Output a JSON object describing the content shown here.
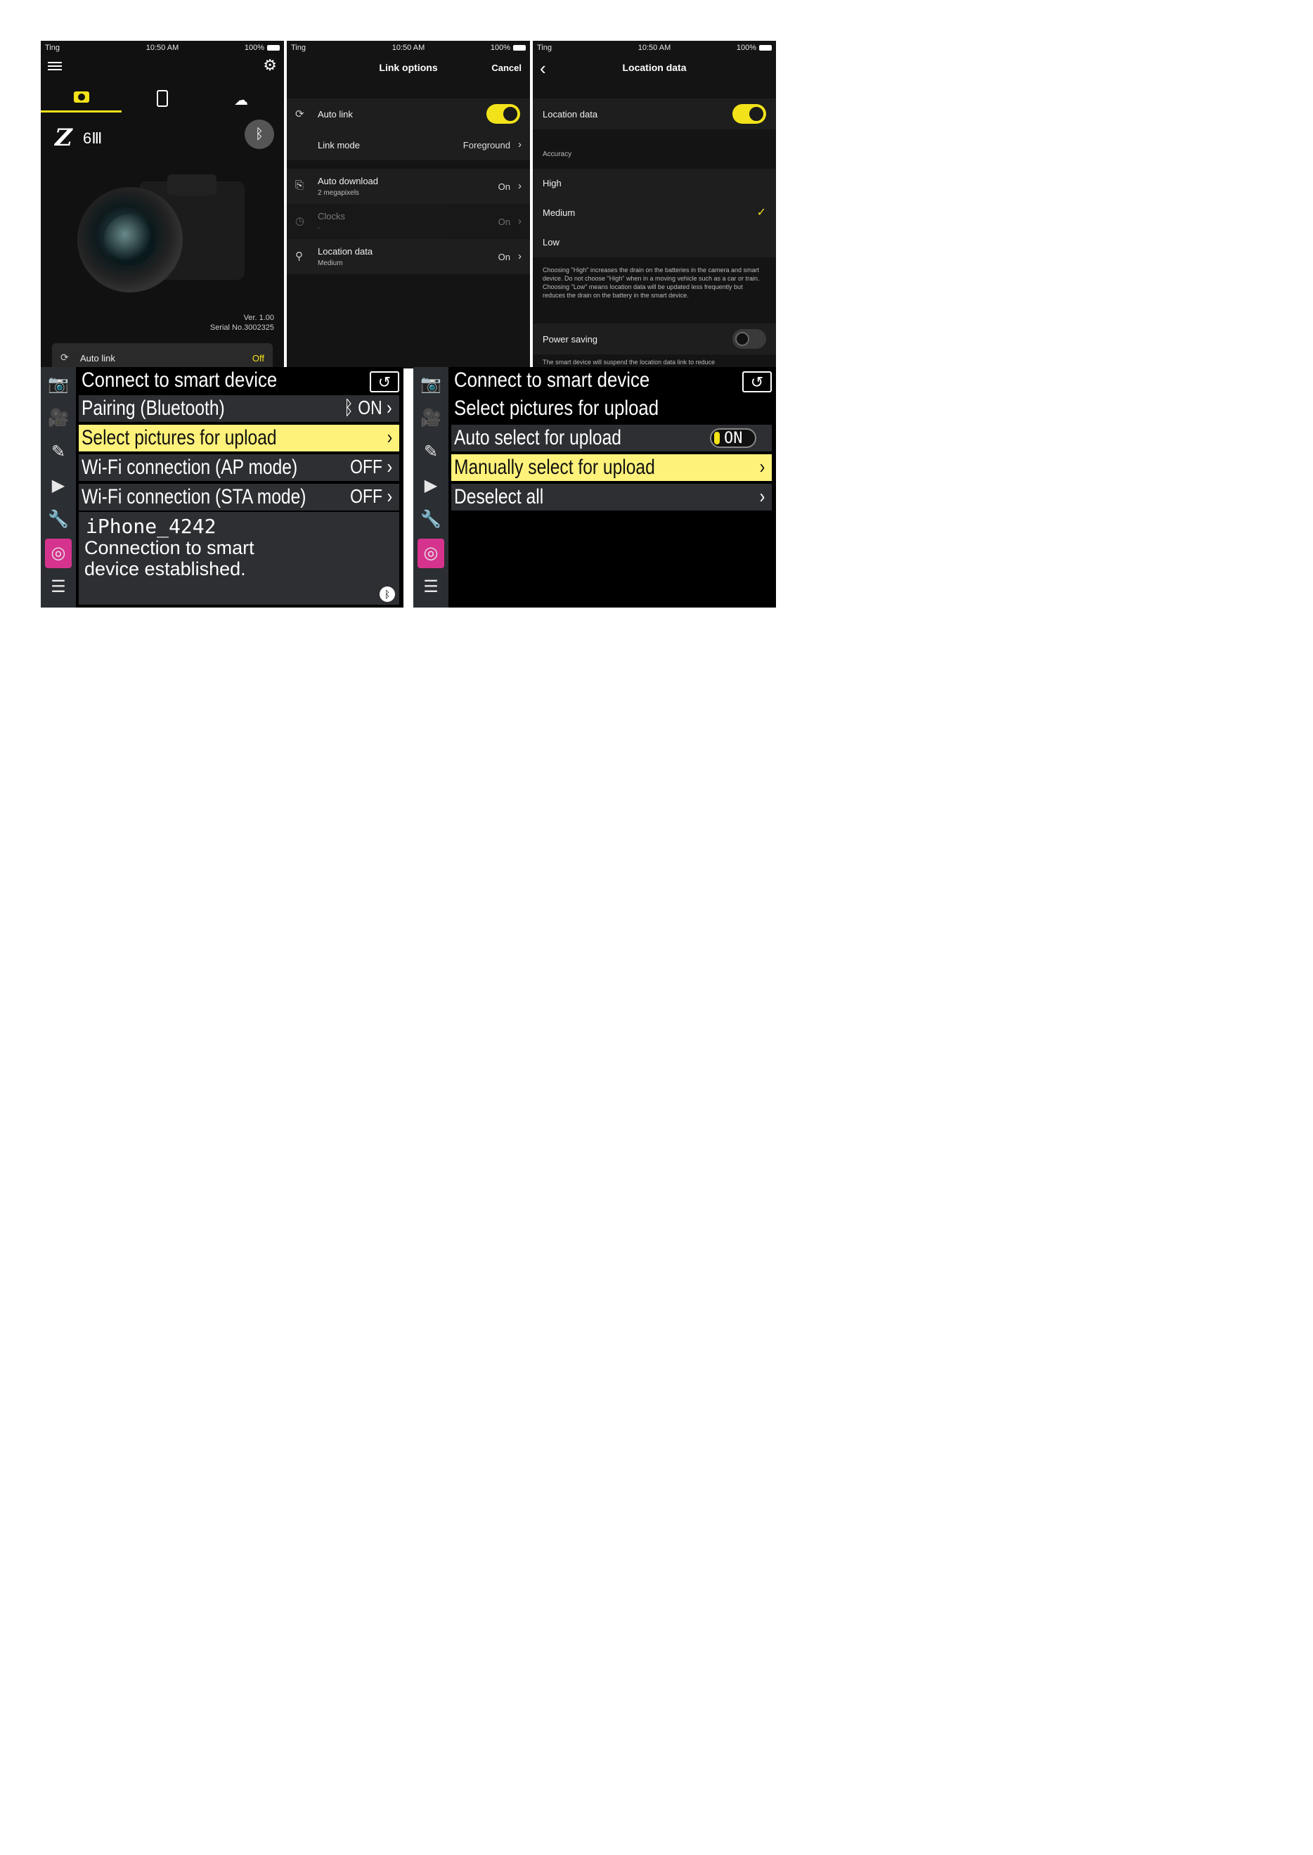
{
  "phone_status": {
    "carrier": "Ting",
    "time": "10:50 AM",
    "battery": "100%"
  },
  "screen1": {
    "model": "6Ⅲ",
    "version": "Ver. 1.00",
    "serial": "Serial No.3002325",
    "auto_link_label": "Auto link",
    "auto_link_value": "Off"
  },
  "screen2": {
    "title": "Link options",
    "cancel": "Cancel",
    "auto_link": "Auto link",
    "link_mode": "Link mode",
    "link_mode_value": "Foreground",
    "auto_download": "Auto download",
    "auto_download_sub": "2 megapixels",
    "auto_download_value": "On",
    "clocks": "Clocks",
    "clocks_sub": "-",
    "clocks_value": "On",
    "location_data": "Location data",
    "location_data_sub": "Medium",
    "location_data_value": "On"
  },
  "screen3": {
    "title": "Location data",
    "location_data": "Location data",
    "accuracy": "Accuracy",
    "high": "High",
    "medium": "Medium",
    "low": "Low",
    "description": "Choosing \"High\" increases the drain on the batteries in the camera and smart device. Do not choose \"High\" when in a moving vehicle such as a car or train. Choosing \"Low\" means location data will be updated less frequently but reduces the drain on the battery in the smart device.",
    "power_saving": "Power saving",
    "power_saving_note": "The smart device will suspend the location data link to reduce"
  },
  "camera_menu1": {
    "title": "Connect to smart device",
    "items": [
      {
        "label": "Pairing (Bluetooth)",
        "value": "ON"
      },
      {
        "label": "Select pictures for upload",
        "value": ""
      },
      {
        "label": "Wi-Fi connection (AP mode)",
        "value": "OFF"
      },
      {
        "label": "Wi-Fi connection (STA mode)",
        "value": "OFF"
      }
    ],
    "device_name": "iPhone_4242",
    "message_line1": "Connection to smart",
    "message_line2": "device established."
  },
  "camera_menu2": {
    "title": "Connect to smart device",
    "subtitle": "Select pictures for upload",
    "items": [
      {
        "label": "Auto select for upload",
        "value": "ON"
      },
      {
        "label": "Manually select for upload",
        "value": ""
      },
      {
        "label": "Deselect all",
        "value": ""
      }
    ]
  },
  "colors": {
    "accent_yellow": "#f2e21a",
    "menu_highlight": "#fff27a",
    "active_tab_magenta": "#d6338e"
  }
}
